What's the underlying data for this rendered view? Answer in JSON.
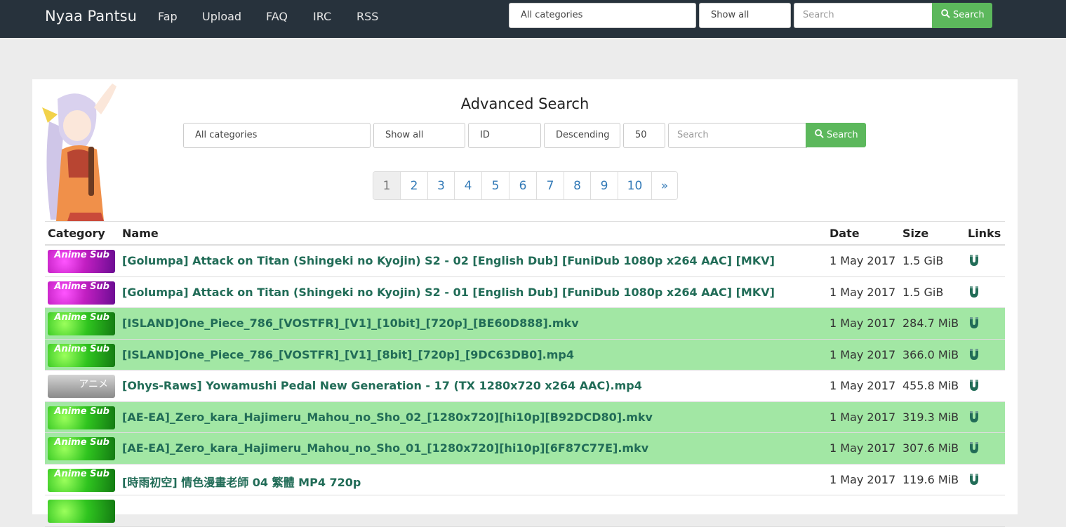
{
  "navbar": {
    "brand": "Nyaa Pantsu",
    "links": [
      "Fap",
      "Upload",
      "FAQ",
      "IRC",
      "RSS"
    ],
    "category_select": "All categories",
    "filter_select": "Show all",
    "search_placeholder": "Search",
    "search_button": "Search"
  },
  "advanced": {
    "title": "Advanced Search",
    "category": "All categories",
    "filter": "Show all",
    "sort": "ID",
    "order": "Descending",
    "limit": "50",
    "search_placeholder": "Search",
    "search_button": "Search"
  },
  "pagination": [
    "1",
    "2",
    "3",
    "4",
    "5",
    "6",
    "7",
    "8",
    "9",
    "10",
    "»"
  ],
  "table": {
    "headers": {
      "category": "Category",
      "name": "Name",
      "date": "Date",
      "size": "Size",
      "links": "Links"
    },
    "rows": [
      {
        "badge": "Anime Sub",
        "name": "[Golumpa] Attack on Titan (Shingeki no Kyojin) S2 - 02 [English Dub] [FuniDub 1080p x264 AAC] [MKV]",
        "date": "1 May 2017",
        "size": "1.5 GiB"
      },
      {
        "badge": "Anime Sub",
        "name": "[Golumpa] Attack on Titan (Shingeki no Kyojin) S2 - 01 [English Dub] [FuniDub 1080p x264 AAC] [MKV]",
        "date": "1 May 2017",
        "size": "1.5 GiB"
      },
      {
        "badge": "Anime Sub",
        "name": "[ISLAND]One_Piece_786_[VOSTFR]_[V1]_[10bit]_[720p]_[BE60D888].mkv",
        "date": "1 May 2017",
        "size": "284.7 MiB"
      },
      {
        "badge": "Anime Sub",
        "name": "[ISLAND]One_Piece_786_[VOSTFR]_[V1]_[8bit]_[720p]_[9DC63DB0].mp4",
        "date": "1 May 2017",
        "size": "366.0 MiB"
      },
      {
        "badge": "アニメ",
        "name": "[Ohys-Raws] Yowamushi Pedal New Generation - 17 (TX 1280x720 x264 AAC).mp4",
        "date": "1 May 2017",
        "size": "455.8 MiB"
      },
      {
        "badge": "Anime Sub",
        "name": "[AE-EA]_Zero_kara_Hajimeru_Mahou_no_Sho_02_[1280x720][hi10p][B92DCD80].mkv",
        "date": "1 May 2017",
        "size": "319.3 MiB"
      },
      {
        "badge": "Anime Sub",
        "name": "[AE-EA]_Zero_kara_Hajimeru_Mahou_no_Sho_01_[1280x720][hi10p][6F87C77E].mkv",
        "date": "1 May 2017",
        "size": "307.6 MiB"
      },
      {
        "badge": "Anime Sub",
        "name": "[時雨初空] 情色漫畫老師 04 繁體 MP4 720p",
        "date": "1 May 2017",
        "size": "119.6 MiB"
      }
    ]
  },
  "colors": {
    "navbar": "#27323c",
    "accent_green": "#5cb85c",
    "trusted_row": "#a2e7a4",
    "link_text": "#216c57"
  },
  "icons": {
    "search": "magnifier-icon",
    "magnet": "magnet-icon"
  }
}
